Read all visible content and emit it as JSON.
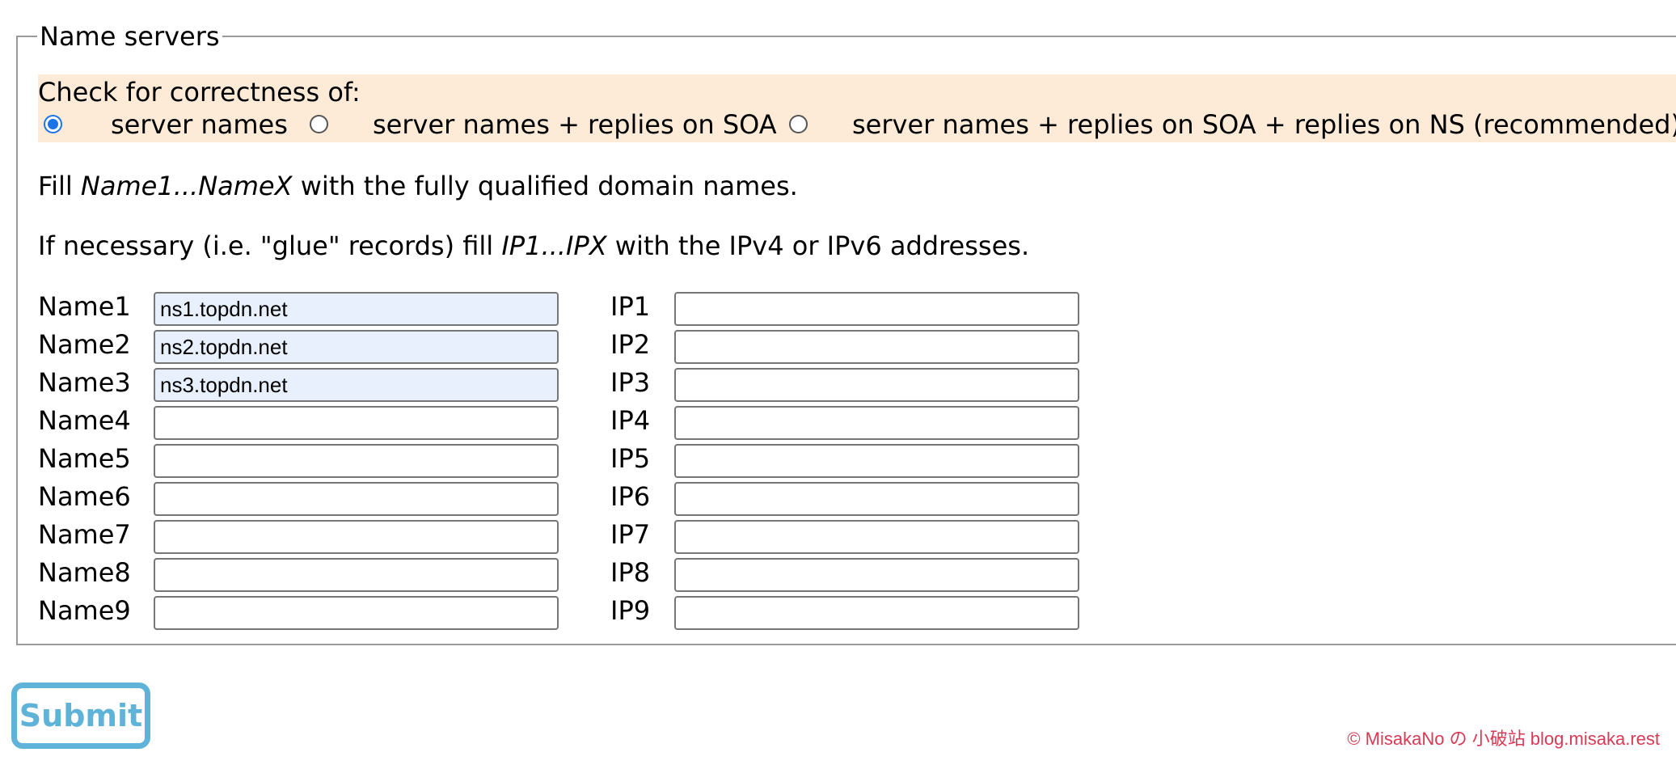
{
  "fieldset": {
    "legend": "Name servers"
  },
  "check": {
    "title": "Check for correctness of:",
    "options": [
      {
        "label": "server names",
        "checked": true
      },
      {
        "label": "server names + replies on SOA",
        "checked": false
      },
      {
        "label": "server names + replies on SOA + replies on NS (recommended)",
        "checked": false
      }
    ]
  },
  "instructions": {
    "line1_prefix": "Fill ",
    "line1_italic": "Name1...NameX",
    "line1_suffix": " with the fully qualified domain names.",
    "line2_prefix": "If necessary (i.e. \"glue\" records) fill ",
    "line2_italic": "IP1...IPX",
    "line2_suffix": " with the IPv4 or IPv6 addresses."
  },
  "rows": [
    {
      "name_label": "Name1",
      "name_value": "ns1.topdn.net",
      "ip_label": "IP1",
      "ip_value": ""
    },
    {
      "name_label": "Name2",
      "name_value": "ns2.topdn.net",
      "ip_label": "IP2",
      "ip_value": ""
    },
    {
      "name_label": "Name3",
      "name_value": "ns3.topdn.net",
      "ip_label": "IP3",
      "ip_value": ""
    },
    {
      "name_label": "Name4",
      "name_value": "",
      "ip_label": "IP4",
      "ip_value": ""
    },
    {
      "name_label": "Name5",
      "name_value": "",
      "ip_label": "IP5",
      "ip_value": ""
    },
    {
      "name_label": "Name6",
      "name_value": "",
      "ip_label": "IP6",
      "ip_value": ""
    },
    {
      "name_label": "Name7",
      "name_value": "",
      "ip_label": "IP7",
      "ip_value": ""
    },
    {
      "name_label": "Name8",
      "name_value": "",
      "ip_label": "IP8",
      "ip_value": ""
    },
    {
      "name_label": "Name9",
      "name_value": "",
      "ip_label": "IP9",
      "ip_value": ""
    }
  ],
  "submit": {
    "label": "Submit"
  },
  "watermark": "© MisakaNo の 小破站 blog.misaka.rest",
  "colors": {
    "highlight_bg": "#fdebd8",
    "autofill_bg": "#e8f0fe",
    "radio_accent": "#1a73e8",
    "submit_accent": "#5fb3d9",
    "watermark": "#d83a55"
  }
}
